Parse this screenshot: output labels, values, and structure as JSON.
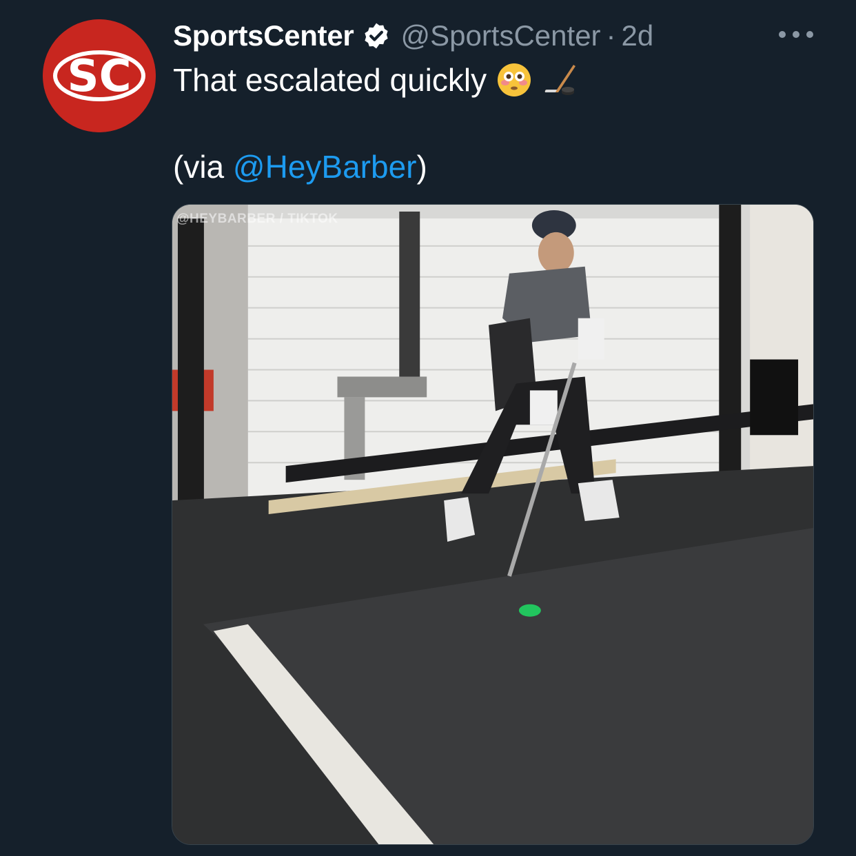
{
  "author": {
    "name": "SportsCenter",
    "handle": "@SportsCenter",
    "separator": "·",
    "time": "2d",
    "avatar_text": "SC",
    "verified": true
  },
  "tweet": {
    "text": "That escalated quickly",
    "emojis": [
      "flushed-face-emoji",
      "ice-hockey-emoji"
    ],
    "via_open": "(via ",
    "via_mention": "@HeyBarber",
    "via_close": ")"
  },
  "media": {
    "watermark": "@HEYBARBER / TIKTOK"
  },
  "colors": {
    "background": "#15202b",
    "text": "#ffffff",
    "secondary": "#8b98a5",
    "link": "#1d9bf0",
    "avatar": "#c8261f"
  }
}
